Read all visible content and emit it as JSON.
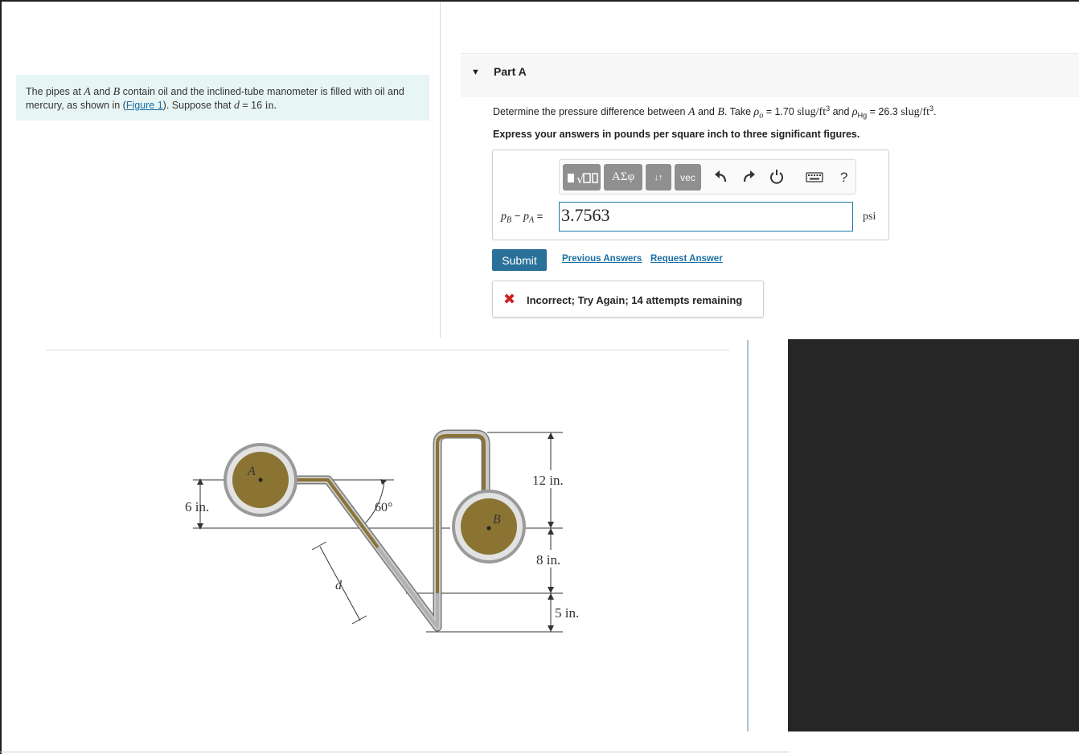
{
  "problem": {
    "intro_pre": "The pipes at ",
    "var_a": "A",
    "and_word": " and ",
    "var_b": "B",
    "intro_mid": " contain oil and the inclined-tube manometer is filled with oil and mercury, as shown in (",
    "figure_link": "Figure 1",
    "intro_post": "). Suppose that ",
    "var_d": "d",
    "intro_eq": " = 16 ",
    "intro_unit": "in",
    "intro_end": "."
  },
  "part": {
    "title": "Part A",
    "q_pre": "Determine the pressure difference between ",
    "q_a": "A",
    "q_and": " and ",
    "q_b": "B",
    "q_take": ". Take ",
    "rho": "ρ",
    "sub_o": "o",
    "eq1": " = 1.70 ",
    "unit1": "slug/ft",
    "cube": "3",
    "q_and2": " and ",
    "sub_hg": "Hg",
    "eq2": " = 26.3 ",
    "unit2": "slug/ft",
    "q_end": ".",
    "instruction": "Express your answers in pounds per square inch to three significant figures."
  },
  "toolbar": {
    "templates_icon": "templates-icon",
    "greek_label": "ΑΣφ",
    "arrows_label": "↓↑",
    "vec_label": "vec",
    "undo_icon": "undo-icon",
    "redo_icon": "redo-icon",
    "reset_icon": "reset-icon",
    "keyboard_icon": "keyboard-icon",
    "help_label": "?"
  },
  "answer": {
    "lhs_p1": "p",
    "lhs_s1": "B",
    "lhs_minus": " − ",
    "lhs_p2": "p",
    "lhs_s2": "A",
    "lhs_eq": " =",
    "value": "3.7563",
    "units": "psi"
  },
  "actions": {
    "submit_label": "Submit",
    "previous_answers": "Previous Answers",
    "request_answer": "Request Answer"
  },
  "feedback": {
    "icon": "✖",
    "message": "Incorrect; Try Again; 14 attempts remaining"
  },
  "figure": {
    "label_a": "A",
    "label_b": "B",
    "label_d": "d",
    "angle": "60°",
    "dim_6": "6 in.",
    "dim_12": "12 in.",
    "dim_8": "8 in.",
    "dim_5": "5 in.",
    "colors": {
      "pipe_fill": "#8b7333",
      "pipe_ring": "#b8b8b8",
      "tube": "#a8a8a8"
    }
  },
  "colors": {
    "accent": "#2a7199",
    "link": "#1a6fa3",
    "error": "#cc1f1f",
    "intro_bg": "#e8f5f5"
  }
}
